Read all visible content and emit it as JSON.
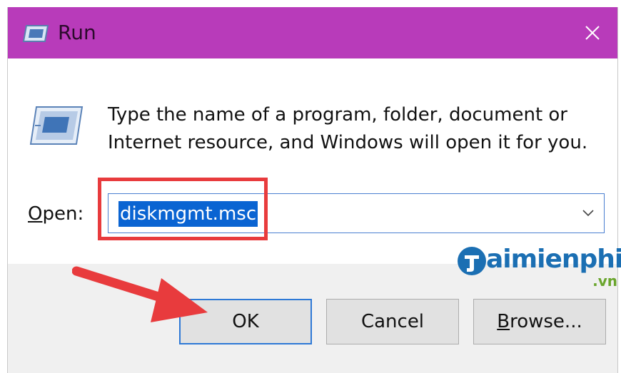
{
  "window": {
    "title": "Run",
    "title_icon": "run-icon",
    "close_icon": "close-icon",
    "titlebar_color": "#b83bba"
  },
  "content": {
    "description_line1": "Type the name of a program, folder, document or",
    "description_line2": "Internet resource, and Windows will open it for you.",
    "open_label_mnemonic": "O",
    "open_label_rest": "pen:",
    "open_value": "diskmgmt.msc"
  },
  "buttons": {
    "ok": "OK",
    "cancel": "Cancel",
    "browse_mnemonic": "B",
    "browse_rest": "rowse..."
  },
  "watermark": {
    "brand": "aimienphi",
    "suffix": ".vn"
  },
  "annotation": {
    "highlight_color": "#e83b3d",
    "arrow_color": "#e83b3d"
  }
}
